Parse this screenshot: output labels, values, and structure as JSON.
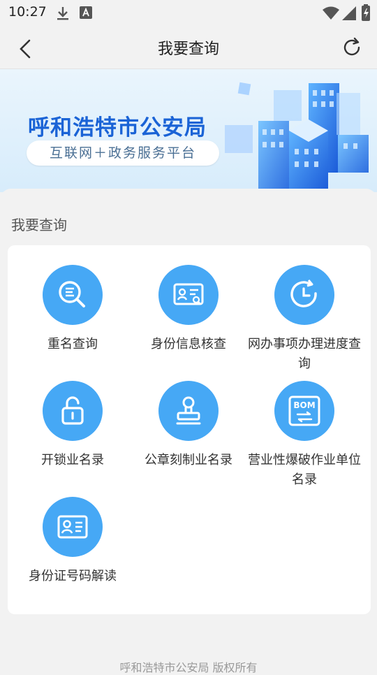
{
  "status_bar": {
    "time": "10:27"
  },
  "header": {
    "title": "我要查询"
  },
  "banner": {
    "title": "呼和浩特市公安局",
    "subtitle": "互联网＋政务服务平台"
  },
  "section": {
    "title": "我要查询"
  },
  "services": [
    {
      "label": "重名查询",
      "icon": "name-search-icon"
    },
    {
      "label": "身份信息核查",
      "icon": "id-card-search-icon"
    },
    {
      "label": "网办事项办理进度查询",
      "icon": "clock-progress-icon"
    },
    {
      "label": "开锁业名录",
      "icon": "unlock-icon"
    },
    {
      "label": "公章刻制业名录",
      "icon": "stamp-icon"
    },
    {
      "label": "营业性爆破作业单位名录",
      "icon": "bom-document-icon",
      "icon_text": "BOM"
    },
    {
      "label": "身份证号码解读",
      "icon": "id-card-icon"
    }
  ],
  "footer": {
    "text": "呼和浩特市公安局 版权所有"
  },
  "colors": {
    "accent": "#46a8f5",
    "banner_title": "#1a63d6"
  }
}
